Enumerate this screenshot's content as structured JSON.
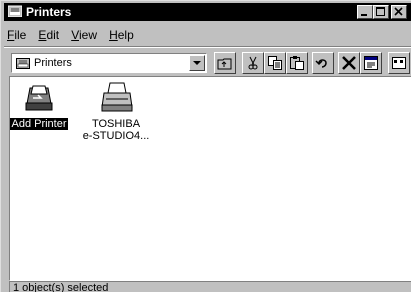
{
  "window": {
    "title": "Printers"
  },
  "menubar": [
    {
      "accel": "F",
      "rest": "ile"
    },
    {
      "accel": "E",
      "rest": "dit"
    },
    {
      "accel": "V",
      "rest": "iew"
    },
    {
      "accel": "H",
      "rest": "elp"
    }
  ],
  "address": {
    "value": "Printers"
  },
  "items": [
    {
      "label": "Add Printer",
      "selected": true,
      "icon": "add-printer-icon"
    },
    {
      "label": "TOSHIBA\ne-STUDIO4...",
      "label_line1": "TOSHIBA",
      "label_line2": "e-STUDIO4...",
      "selected": false,
      "icon": "printer-icon"
    }
  ],
  "status": {
    "text": "1 object(s) selected"
  }
}
